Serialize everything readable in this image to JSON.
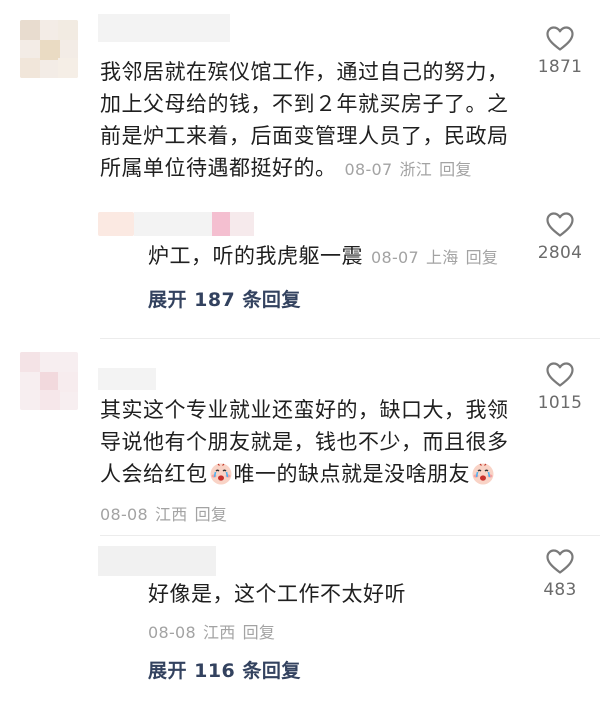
{
  "comments": [
    {
      "text_lines": [
        "我邻居就在殡仪馆工作，通过自己的努力，",
        "加上父母给的钱，不到２年就买房子了。之",
        "前是炉工来着，后面变管理人员了，民政局",
        "所属单位待遇都挺好的。"
      ],
      "date": "08-07",
      "location": "浙江",
      "reply_label": "回复",
      "likes": "1871",
      "replies": [
        {
          "text": "炉工，听的我虎躯一震",
          "date": "08-07",
          "location": "上海",
          "reply_label": "回复",
          "likes": "2804"
        }
      ],
      "expand_label": "展开 187 条回复"
    },
    {
      "text_lines": [
        "其实这个专业就业还蛮好的，缺口大，我领",
        "导说他有个朋友就是，钱也不少，而且很多"
      ],
      "line3_a": "人会给红包",
      "line3_b": "唯一的缺点就是没啥朋友",
      "date": "08-08",
      "location": "江西",
      "reply_label": "回复",
      "likes": "1015",
      "replies": [
        {
          "text": "好像是，这个工作不太好听",
          "date": "08-08",
          "location": "江西",
          "reply_label": "回复",
          "likes": "483"
        }
      ],
      "expand_label": "展开 116 条回复"
    }
  ],
  "icons": {
    "like": "heart-outline-icon",
    "emoji": "crying-face-emoji-icon"
  },
  "colors": {
    "text": "#1f1f1f",
    "meta": "#a3a3a3",
    "expand": "#33425f",
    "like_icon": "#7a7a7a"
  }
}
